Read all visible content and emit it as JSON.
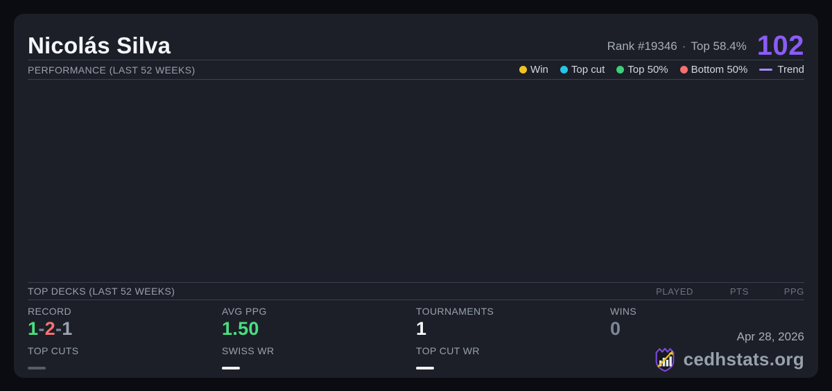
{
  "header": {
    "player_name": "Nicolás Silva",
    "rank": "Rank #19346",
    "separator": "·",
    "percentile": "Top 58.4%",
    "score": "102"
  },
  "performance": {
    "title": "PERFORMANCE (LAST 52 WEEKS)",
    "legend": [
      {
        "label": "Win",
        "color": "#f0c420",
        "marker": "dot"
      },
      {
        "label": "Top cut",
        "color": "#27c4e8",
        "marker": "dot"
      },
      {
        "label": "Top 50%",
        "color": "#3ecf7a",
        "marker": "dot"
      },
      {
        "label": "Bottom 50%",
        "color": "#f4716f",
        "marker": "dot"
      },
      {
        "label": "Trend",
        "color": "#a78bfa",
        "marker": "line"
      }
    ],
    "chart_points": []
  },
  "top_decks": {
    "title": "TOP DECKS (LAST 52 WEEKS)",
    "columns": [
      "PLAYED",
      "PTS",
      "PPG"
    ],
    "rows": []
  },
  "stats": {
    "record": {
      "label": "RECORD",
      "wins": "1",
      "sep1": "-",
      "losses": "2",
      "sep2": "-",
      "draws": "1"
    },
    "avg_ppg": {
      "label": "AVG PPG",
      "value": "1.50"
    },
    "tournaments": {
      "label": "TOURNAMENTS",
      "value": "1"
    },
    "wins": {
      "label": "WINS",
      "value": "0"
    },
    "top_cuts": {
      "label": "TOP CUTS",
      "empty": true
    },
    "swiss_wr": {
      "label": "SWISS WR",
      "empty": true
    },
    "top_cut_wr": {
      "label": "TOP CUT WR",
      "empty": true
    }
  },
  "footer": {
    "date": "Apr 28, 2026",
    "brand": "cedhstats.org"
  },
  "colors": {
    "page_bg": "#0a0c11",
    "card_bg": "#1c1f28",
    "divider": "#3a4150",
    "accent_purple": "#8b5cf6",
    "trend_purple": "#a78bfa",
    "win_yellow": "#f0c420",
    "top_cut_cyan": "#27c4e8",
    "top50_green": "#3ecf7a",
    "bottom50_red": "#f4716f",
    "positive_green": "#4ade80",
    "negative_red": "#f87171"
  }
}
